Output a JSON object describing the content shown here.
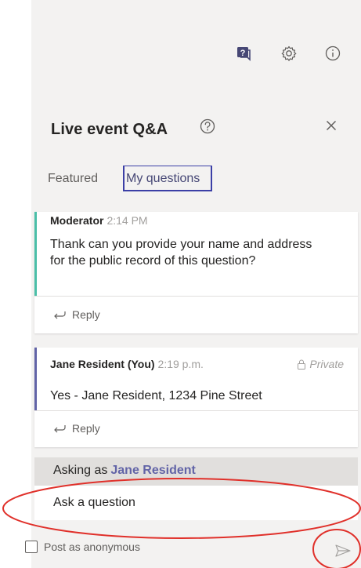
{
  "header": {
    "icons": [
      "qna-icon",
      "gear-icon",
      "info-icon"
    ]
  },
  "qa": {
    "title": "Live event Q&A",
    "tabs": [
      {
        "label": "Featured"
      },
      {
        "label": "My questions",
        "selected": true
      }
    ]
  },
  "messages": [
    {
      "author": "Moderator",
      "time": "2:14 PM",
      "text": "Thank can you provide your name and address for the public record of this question?",
      "reply_label": "Reply",
      "accent": "#4bbfa8"
    },
    {
      "author": "Jane Resident (You)",
      "time": "2:19 p.m.",
      "private_label": "Private",
      "text": "Yes - Jane Resident, 1234 Pine Street",
      "reply_label": "Reply",
      "accent": "#6264a7"
    }
  ],
  "compose": {
    "asking_as_label": "Asking as",
    "asking_as_name": "Jane Resident",
    "input_placeholder": "Ask a question",
    "anonymous_label": "Post as anonymous"
  },
  "colors": {
    "brand": "#6264a7",
    "annotation": "#e0302a"
  }
}
